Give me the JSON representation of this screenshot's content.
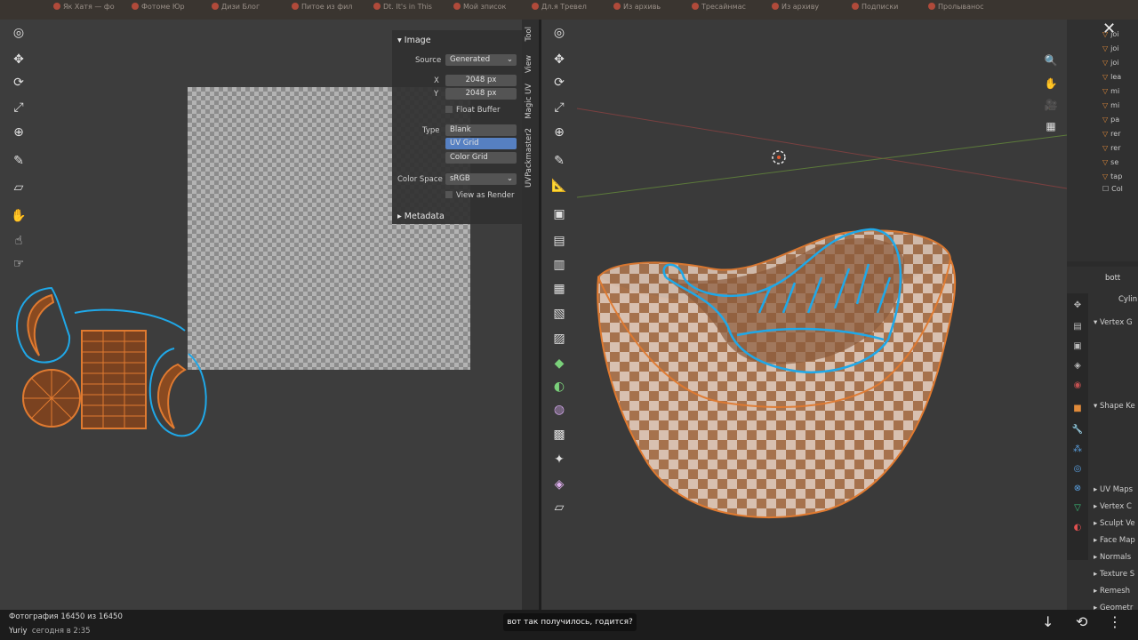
{
  "browser_tabs": [
    "Як Хатя —  фо",
    "Фотоме Юр",
    "Дизи Блог",
    "Питое из фил",
    "Dt. It's in This",
    "Мой зписок",
    "Дл.я Тревел",
    "Из архивь",
    "Тресайнмас",
    "Из архиву",
    "Подписки",
    "Пролыванос"
  ],
  "uv_panel": {
    "header": "Image",
    "source_label": "Source",
    "source_value": "Generated",
    "x_label": "X",
    "x_value": "2048 px",
    "y_label": "Y",
    "y_value": "2048 px",
    "float_buffer": "Float Buffer",
    "type_label": "Type",
    "type_options": [
      "Blank",
      "UV Grid",
      "Color Grid"
    ],
    "type_selected": "UV Grid",
    "color_space_label": "Color Space",
    "color_space_value": "sRGB",
    "view_as_render": "View as Render",
    "metadata": "Metadata"
  },
  "side_tabs": [
    "Tool",
    "View",
    "Magic UV",
    "UVPackmaster2"
  ],
  "outliner_items": [
    "joi",
    "joi",
    "joi",
    "lea",
    "mi",
    "mi",
    "pa",
    "rer",
    "rer",
    "se",
    "tap",
    "Col"
  ],
  "props": {
    "object_name": "bott",
    "mesh_name": "Cylin",
    "sections": [
      "Vertex G",
      "Shape Ke",
      "UV Maps",
      "Vertex C",
      "Sculpt Ve",
      "Face Map",
      "Normals",
      "Texture S",
      "Remesh",
      "Geometr"
    ]
  },
  "photo_info": {
    "counter": "Фотография 16450 из 16450",
    "author": "Yuriy",
    "time": "сегодня в 2:35"
  },
  "caption": "вот так получилось, годится?",
  "colors": {
    "accent": "#5680c2",
    "annotation": "#1fa8e8",
    "mesh_orange": "#e07a30"
  }
}
